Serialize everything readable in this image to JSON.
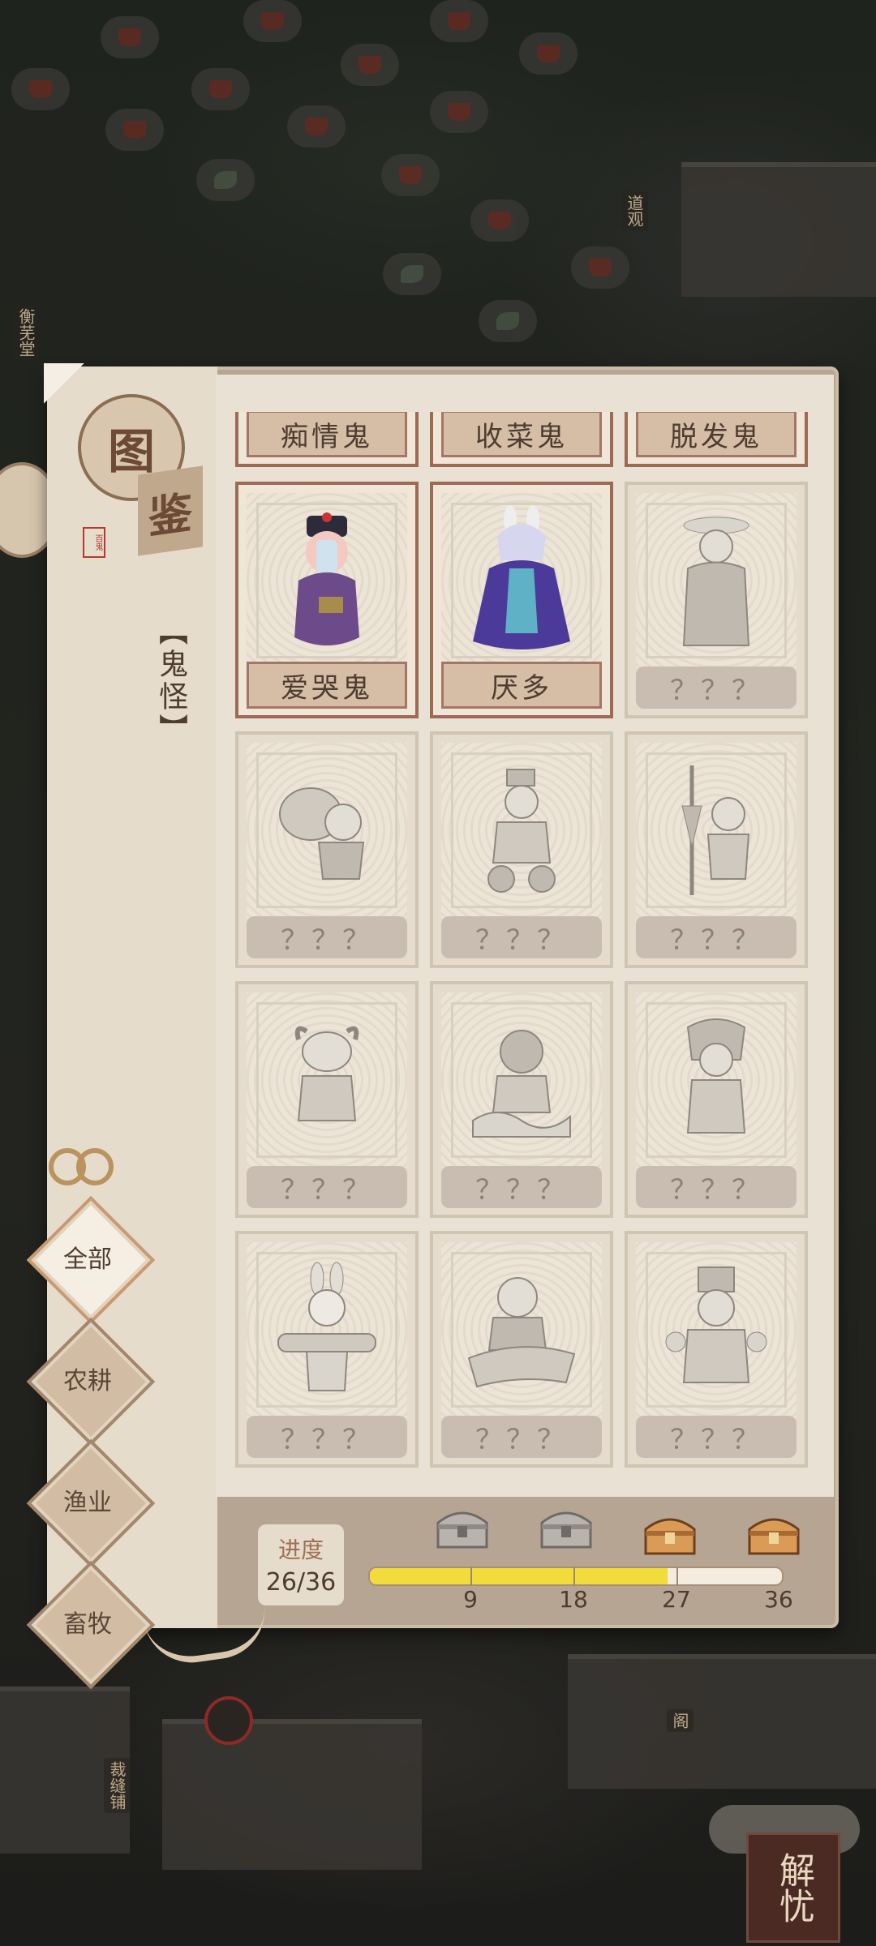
{
  "map": {
    "labels": [
      "衡芜堂",
      "道观",
      "裁缝铺",
      "阁"
    ]
  },
  "encyclopedia": {
    "title_char_1": "图",
    "title_char_2": "鉴",
    "stamp_text": "百鬼",
    "category_title": "【鬼怪】",
    "tabs": [
      {
        "label": "全部",
        "active": true
      },
      {
        "label": "农耕",
        "active": false
      },
      {
        "label": "渔业",
        "active": false
      },
      {
        "label": "畜牧",
        "active": false
      }
    ],
    "cards": [
      {
        "name": "痴情鬼",
        "unlocked": true,
        "partial": true
      },
      {
        "name": "收菜鬼",
        "unlocked": true,
        "partial": true
      },
      {
        "name": "脱发鬼",
        "unlocked": true,
        "partial": true
      },
      {
        "name": "爱哭鬼",
        "unlocked": true
      },
      {
        "name": "厌多",
        "unlocked": true
      },
      {
        "name": "？？？",
        "unlocked": false
      },
      {
        "name": "？？？",
        "unlocked": false
      },
      {
        "name": "？？？",
        "unlocked": false
      },
      {
        "name": "？？？",
        "unlocked": false
      },
      {
        "name": "？？？",
        "unlocked": false
      },
      {
        "name": "？？？",
        "unlocked": false
      },
      {
        "name": "？？？",
        "unlocked": false
      },
      {
        "name": "？？？",
        "unlocked": false
      },
      {
        "name": "？？？",
        "unlocked": false
      },
      {
        "name": "？？？",
        "unlocked": false
      }
    ],
    "progress": {
      "label": "进度",
      "value_text": "26/36",
      "current": 26,
      "total": 36,
      "milestones": [
        {
          "value": "9",
          "chest": "silver-chest-icon",
          "claimed": true
        },
        {
          "value": "18",
          "chest": "silver-chest-icon",
          "claimed": true
        },
        {
          "value": "27",
          "chest": "gold-chest-icon",
          "claimed": false
        },
        {
          "value": "36",
          "chest": "gold-chest-icon",
          "claimed": false
        }
      ]
    }
  },
  "corner_button": {
    "label": "解忧"
  },
  "colors": {
    "accent_brown": "#9e6a55",
    "progress_fill": "#f2dc3b",
    "parchment": "#e9e1d3"
  }
}
